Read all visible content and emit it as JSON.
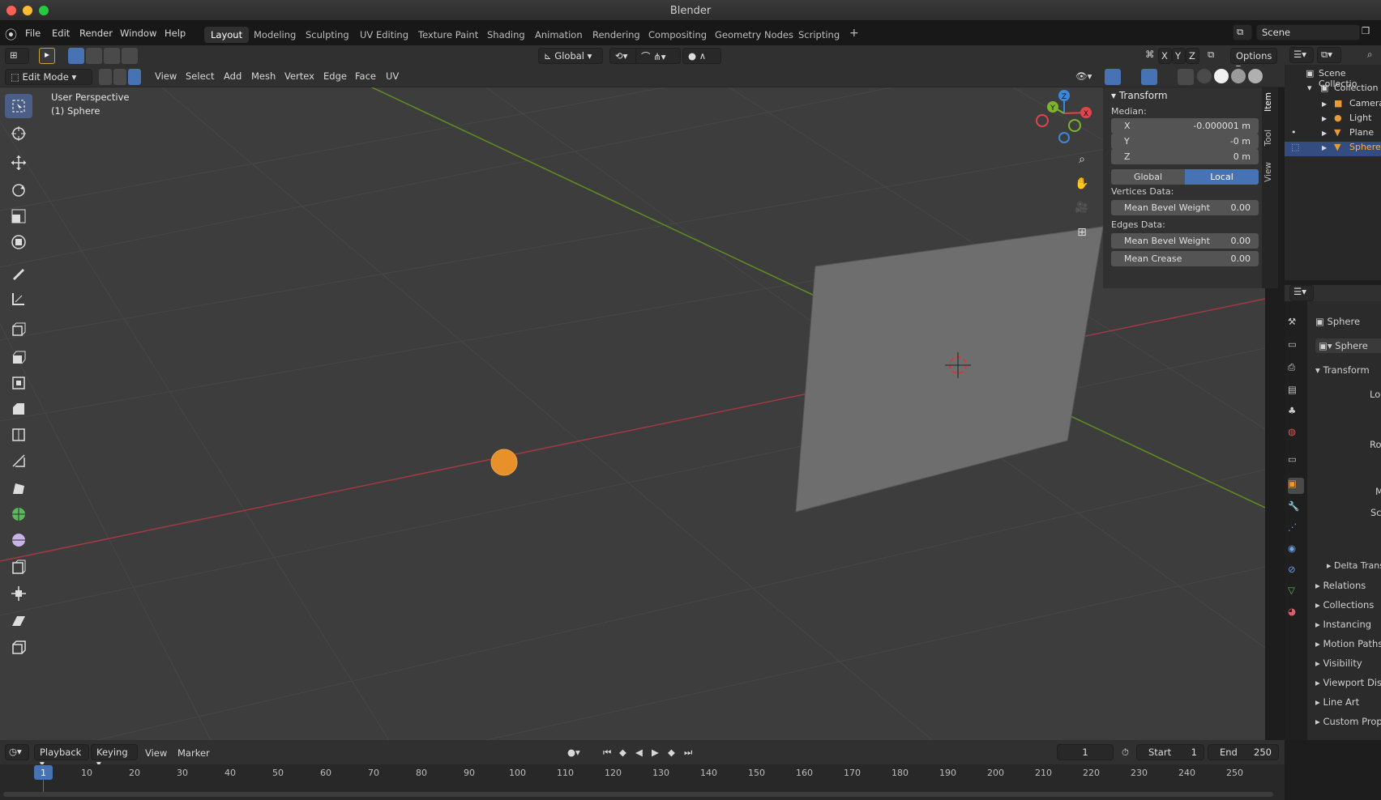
{
  "window": {
    "title": "Blender"
  },
  "menu": [
    "File",
    "Edit",
    "Render",
    "Window",
    "Help"
  ],
  "workspaces": [
    "Layout",
    "Modeling",
    "Sculpting",
    "UV Editing",
    "Texture Paint",
    "Shading",
    "Animation",
    "Rendering",
    "Compositing",
    "Geometry Nodes",
    "Scripting"
  ],
  "active_workspace": "Layout",
  "scene": {
    "label": "Scene"
  },
  "header1": {
    "orientation": "Global",
    "axes": [
      "X",
      "Y",
      "Z"
    ],
    "options": "Options"
  },
  "header2": {
    "mode": "Edit Mode",
    "menus": [
      "View",
      "Select",
      "Add",
      "Mesh",
      "Vertex",
      "Edge",
      "Face",
      "UV"
    ]
  },
  "viewport": {
    "perspective": "User Perspective",
    "object": "(1) Sphere"
  },
  "gizmo": {
    "axes": [
      "X",
      "Y",
      "Z"
    ],
    "colors": {
      "x": "#e2434d",
      "y": "#7fb32d",
      "z": "#3b87d9"
    }
  },
  "npanel": {
    "title": "Transform",
    "median_label": "Median:",
    "fields": [
      {
        "axis": "X",
        "value": "-0.000001 m"
      },
      {
        "axis": "Y",
        "value": "-0 m"
      },
      {
        "axis": "Z",
        "value": "0 m"
      }
    ],
    "toggle": [
      "Global",
      "Local"
    ],
    "active_toggle": "Local",
    "vertices_label": "Vertices Data:",
    "vertices": [
      {
        "label": "Mean Bevel Weight",
        "value": "0.00"
      }
    ],
    "edges_label": "Edges Data:",
    "edges": [
      {
        "label": "Mean Bevel Weight",
        "value": "0.00"
      },
      {
        "label": "Mean Crease",
        "value": "0.00"
      }
    ],
    "tabs": [
      "Item",
      "Tool",
      "View"
    ]
  },
  "outliner": {
    "root": "Scene Collectio",
    "collection": "Collection",
    "items": [
      "Camera",
      "Light",
      "Plane",
      "Sphere"
    ],
    "selected": "Sphere"
  },
  "properties": {
    "object_name": "Sphere",
    "data_name": "Sphere",
    "transform": "Transform",
    "location": "Locatic",
    "rotation": "Rotatic",
    "mode": "M",
    "scale": "Sca",
    "delta": "Delta Trans",
    "sections": [
      "Relations",
      "Collections",
      "Instancing",
      "Motion Paths",
      "Visibility",
      "Viewport Dis",
      "Line Art",
      "Custom Prop"
    ]
  },
  "timeline": {
    "menus": [
      "Playback",
      "Keying",
      "View",
      "Marker"
    ],
    "current_frame": "1",
    "start_label": "Start",
    "start": "1",
    "end_label": "End",
    "end": "250",
    "ticks": [
      "1",
      "10",
      "20",
      "30",
      "40",
      "50",
      "60",
      "70",
      "80",
      "90",
      "100",
      "110",
      "120",
      "130",
      "140",
      "150",
      "160",
      "170",
      "180",
      "190",
      "200",
      "210",
      "220",
      "230",
      "240",
      "250"
    ]
  },
  "colors": {
    "accent": "#4772b3",
    "sphere": "#e8902a",
    "x_axis": "#b13a44",
    "y_axis": "#6a9a22"
  }
}
